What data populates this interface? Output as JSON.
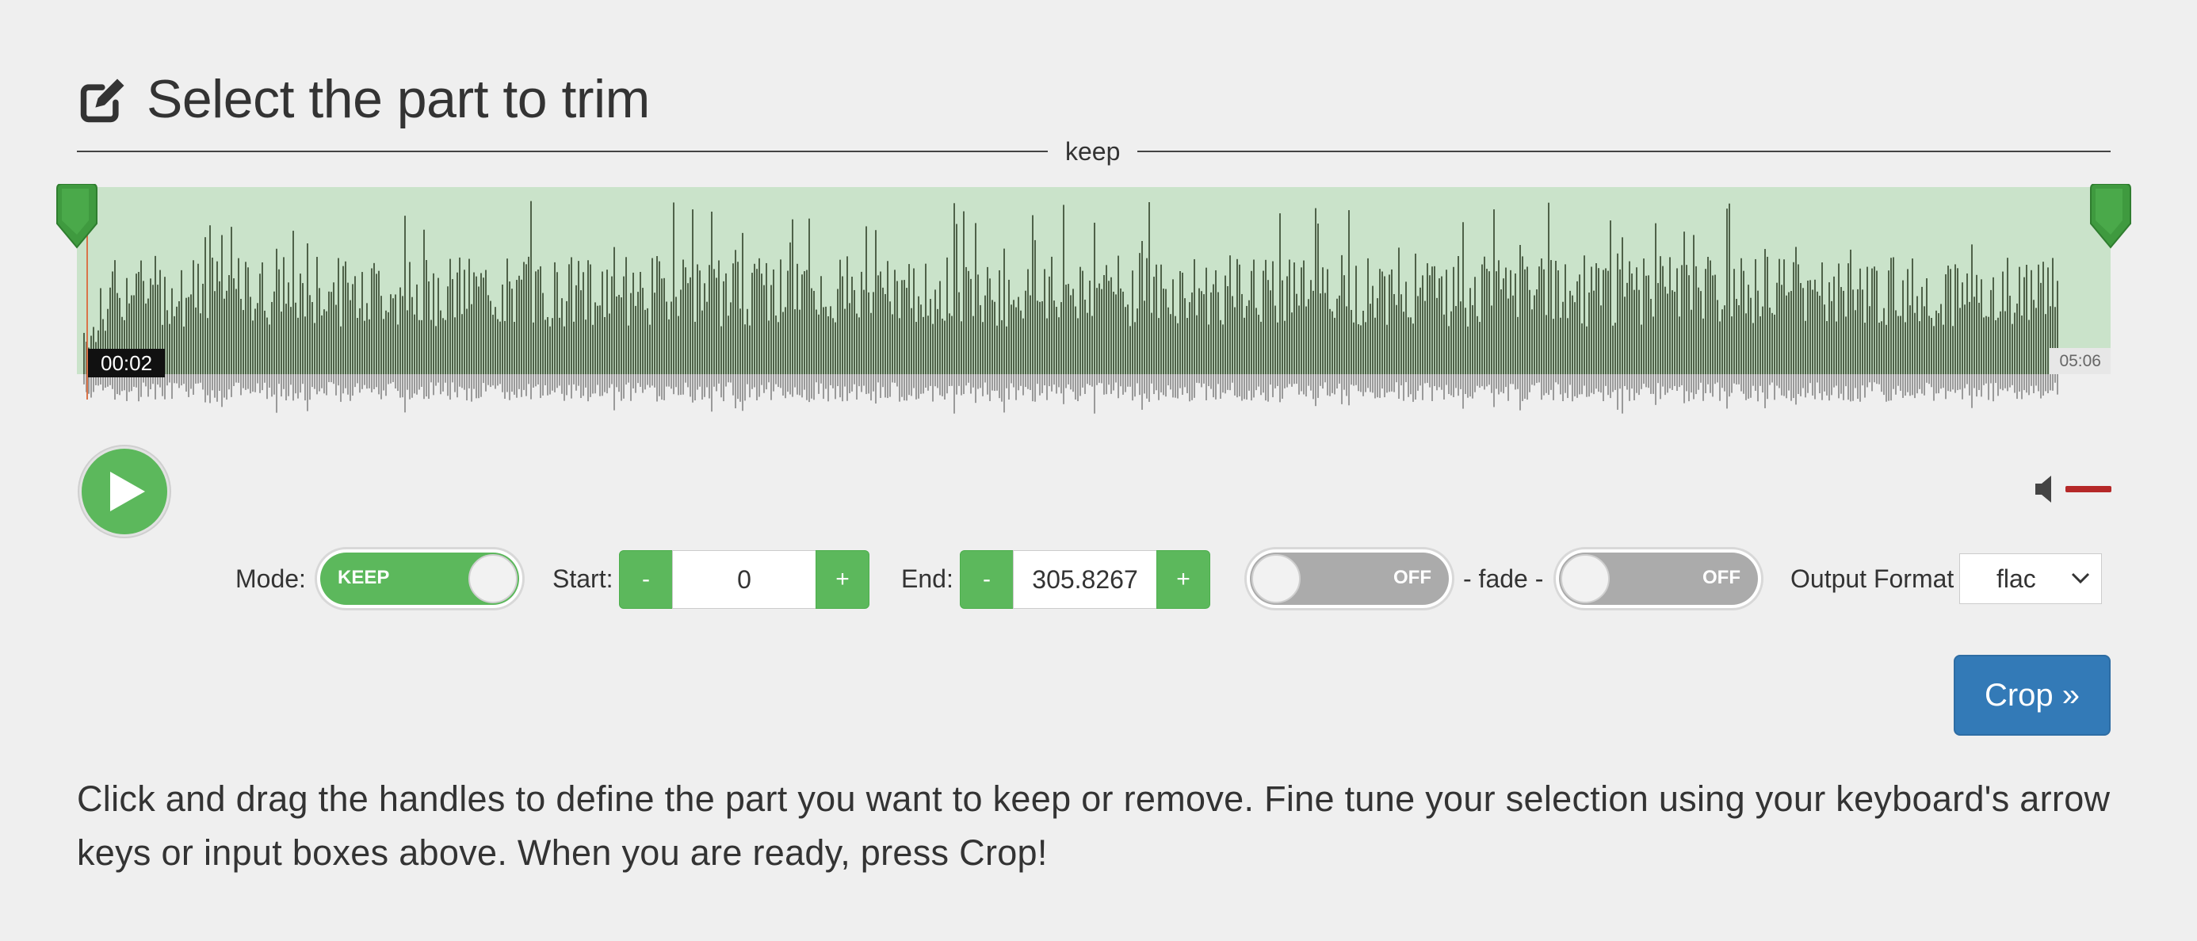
{
  "page": {
    "title": "Select the part to trim",
    "help_text": "Click and drag the handles to define the part you want to keep or remove. Fine tune your selection using your keyboard's arrow keys or input boxes above. When you are ready, press Crop!"
  },
  "region": {
    "label": "keep"
  },
  "player": {
    "current_time": "00:02",
    "end_time": "05:06",
    "volume_level": 1.0
  },
  "controls": {
    "mode_label": "Mode:",
    "mode_value": "KEEP",
    "start_label": "Start:",
    "start_value": "0",
    "end_label": "End:",
    "end_value": "305.8267",
    "minus": "-",
    "plus": "+",
    "fade_in_state": "OFF",
    "fade_label": "- fade -",
    "fade_out_state": "OFF",
    "output_format_label": "Output Format",
    "output_format_value": "flac",
    "crop_label": "Crop »"
  },
  "colors": {
    "accent_green": "#5cb85c",
    "primary_blue": "#337ab7",
    "selection_bg": "#cae3ca",
    "wave_selected": "#4f6249",
    "wave_reflection": "#9a9a9a",
    "volume_red": "#b52828"
  },
  "icons": {
    "title_icon": "edit-icon",
    "play": "play-icon",
    "volume": "speaker-icon",
    "select": "chevron-down-icon",
    "handle": "marker-handle-icon"
  }
}
